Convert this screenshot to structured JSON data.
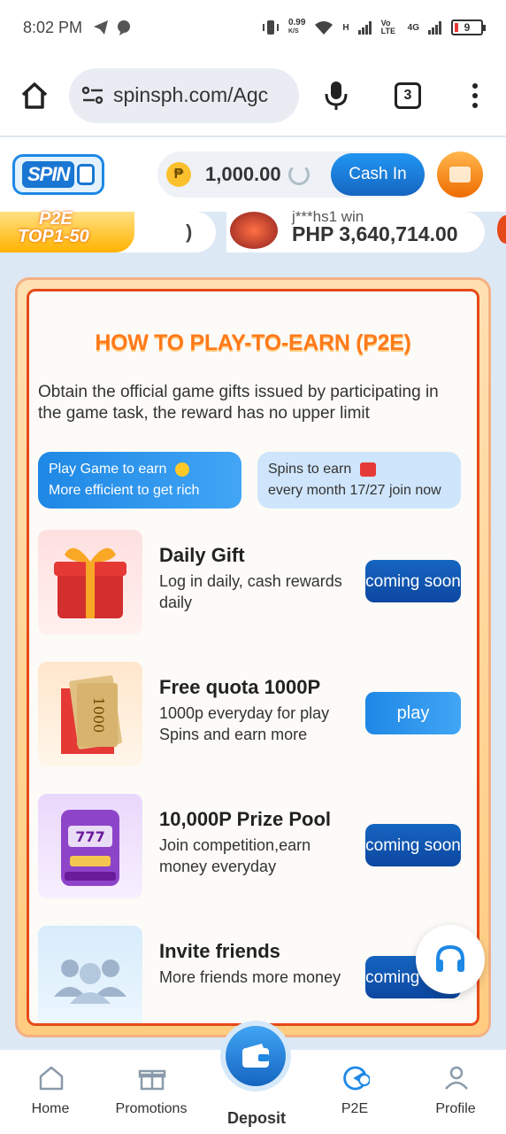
{
  "status_bar": {
    "time": "8:02 PM",
    "net_speed": "0.99",
    "net_unit": "K/S",
    "signal_h": "H",
    "volte": "Vo LTE",
    "signal_4g": "4G",
    "battery": "9"
  },
  "browser": {
    "url": "spinsph.com/Agc",
    "tab_count": "3"
  },
  "header": {
    "logo_text": "SPIN",
    "currency_symbol": "₱",
    "balance": "1,000.00",
    "cash_in_label": "Cash In"
  },
  "ticker": {
    "badge_line1": "P2E",
    "badge_line2": "TOP1-50",
    "partial_text": ")",
    "user": "j***hs1 win",
    "amount": "PHP 3,640,714.00"
  },
  "card": {
    "title": "HOW TO PLAY-TO-EARN (P2E)",
    "description": "Obtain the official game gifts issued by participating in the game task, the reward has no upper limit",
    "pill_a": {
      "line1": "Play Game to earn",
      "line2": "More efficient to get rich"
    },
    "pill_b": {
      "line1": "Spins to earn",
      "line2": "every month 17/27 join now"
    },
    "rows": [
      {
        "title": "Daily Gift",
        "desc": "Log in daily, cash rewards daily",
        "button": "coming soon"
      },
      {
        "title": "Free quota 1000P",
        "desc": "1000p everyday for play Spins and earn more",
        "button": "play"
      },
      {
        "title": "10,000P Prize Pool",
        "desc": "Join competition,earn money everyday",
        "button": "coming soon"
      },
      {
        "title": "Invite friends",
        "desc": "More friends more money",
        "button": "coming soon"
      }
    ],
    "money_text": "1000",
    "slot_text": "777"
  },
  "nav": {
    "home": "Home",
    "promotions": "Promotions",
    "deposit": "Deposit",
    "p2e": "P2E",
    "profile": "Profile"
  },
  "colors": {
    "primary_blue": "#1e88e5",
    "dark_blue": "#0d47a1",
    "orange_title": "#ff7a1a",
    "card_border": "#e64a19"
  }
}
